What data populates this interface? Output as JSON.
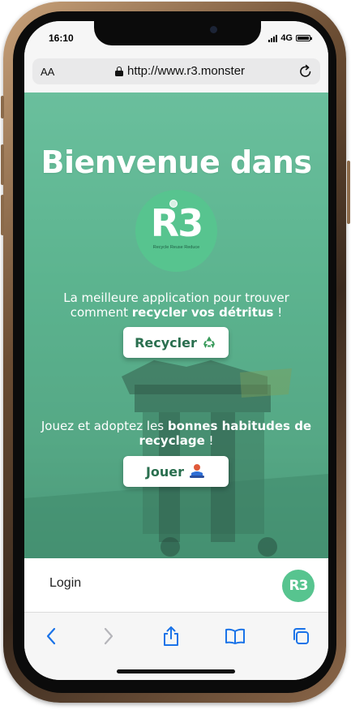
{
  "status_bar": {
    "time": "16:10",
    "network": "4G"
  },
  "browser": {
    "text_size_label": "AA",
    "url": "http://www.r3.monster"
  },
  "hero": {
    "title": "Bienvenue dans",
    "logo_text": "R3",
    "logo_tagline": "Recycle Reuse Reduce",
    "recycle_intro": "La meilleure application pour trouver comment ",
    "recycle_bold": "recycler vos détritus",
    "recycle_end": " !",
    "recycle_button": "Recycler",
    "play_intro": "Jouez et adoptez les ",
    "play_bold": "bonnes habitudes de recyclage",
    "play_end": " !",
    "play_button": "Jouer"
  },
  "app_bar": {
    "login_label": "Login",
    "avatar_text": "R3"
  },
  "icons": {
    "recycle": "recycle-icon",
    "play": "person-icon",
    "back": "chevron-left-icon",
    "forward": "chevron-right-icon",
    "share": "share-icon",
    "bookmarks": "book-icon",
    "tabs": "tabs-icon"
  },
  "colors": {
    "brand_green": "#57c48f",
    "ios_blue": "#1a73e8",
    "button_text": "#2a6f4f"
  }
}
